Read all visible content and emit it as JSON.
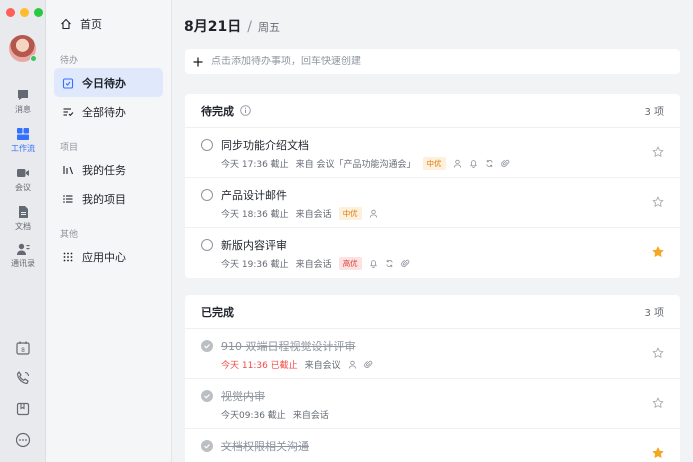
{
  "rail": {
    "items": [
      {
        "label": "消息"
      },
      {
        "label": "工作流"
      },
      {
        "label": "会议"
      },
      {
        "label": "文档"
      },
      {
        "label": "通讯录"
      }
    ],
    "active_color": "#3370ff"
  },
  "nav": {
    "home": "首页",
    "sections": {
      "todo": "待办",
      "project": "项目",
      "other": "其他"
    },
    "items": {
      "today": "今日待办",
      "all": "全部待办",
      "my_tasks": "我的任务",
      "my_projects": "我的项目",
      "app_center": "应用中心"
    }
  },
  "header": {
    "date": "8月21日",
    "separator": "/",
    "weekday": "周五"
  },
  "quick_add": {
    "placeholder": "点击添加待办事项，回车快速创建"
  },
  "pending": {
    "title": "待完成",
    "count": "3 项",
    "tasks": [
      {
        "title": "同步功能介绍文档",
        "due": "今天 17:36 截止",
        "source": "来自 会议「产品功能沟通会」",
        "priority": "中优",
        "starred": false
      },
      {
        "title": "产品设计邮件",
        "due": "今天 18:36 截止",
        "source": "来自会话",
        "priority": "中优",
        "starred": false
      },
      {
        "title": "新版内容评审",
        "due": "今天 19:36 截止",
        "source": "来自会话",
        "priority": "高优",
        "starred": true
      }
    ]
  },
  "completed": {
    "title": "已完成",
    "count": "3 项",
    "tasks": [
      {
        "title": "910 双端日程视觉设计评审",
        "due": "今天 11:36 已截止",
        "source": "来自会议",
        "starred": false
      },
      {
        "title": "视觉内审",
        "due": "今天09:36 截止",
        "source": "来自会话",
        "starred": false
      },
      {
        "title": "文档权限相关沟通",
        "starred": true
      }
    ]
  },
  "colors": {
    "accent": "#3370ff",
    "star": "#f5a623",
    "overdue": "#f54a45"
  }
}
